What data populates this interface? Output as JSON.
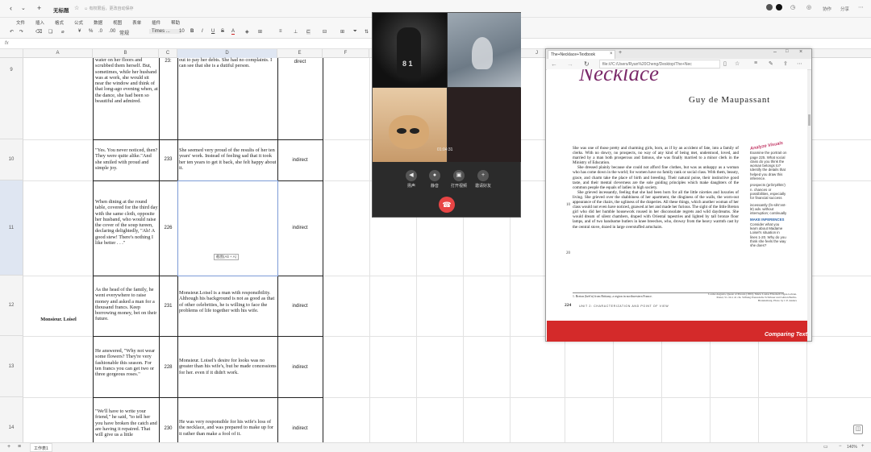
{
  "titlebar": {
    "doc_title": "无标题",
    "sync_text": "☺ 有权限后，更改自动保存",
    "collab_label": "协作",
    "share_label": "分享"
  },
  "menu": [
    "文件",
    "插入",
    "格式",
    "公式",
    "数据",
    "视图",
    "表单",
    "插件",
    "帮助"
  ],
  "toolbar": {
    "normal": "常规",
    "font": "Times ...",
    "font_size": "10",
    "percent": "%",
    "currency": "¥"
  },
  "formula_bar": {
    "cell_label": "fx"
  },
  "columns": [
    "A",
    "B",
    "C",
    "D",
    "E",
    "F",
    "G",
    "H",
    "I",
    "J"
  ],
  "rows": [
    {
      "num": "9",
      "quote": "water on her floors and scrubbed them herself. But, sometimes, while her husband was at work, she would sit near the window and think of that long-ago evening when, at the dance, she had been so beautiful and admired.",
      "page": "23:",
      "analysis": "out to pay her debts. She had no complaints. I can see that she is a dutiful person.",
      "type": "direct"
    },
    {
      "num": "10",
      "quote": "\"Yes. You never noticed, then? They were quite alike.\"And she smiled with proud and simple joy.",
      "page": "233",
      "analysis": "She seemed very proud of the results of her ten years' work. Instead of feeling sad that it took her ten years to get it back, she felt happy about it.",
      "type": "indirect"
    },
    {
      "num": "11",
      "quote": "When dining at the round table, covered for the third day with the same cloth, opposite her husband, who would raise the cover of the soup tureen, declaring delightedly, \"Ah! A good stew! There's nothing I like better . . .\"",
      "page": "226",
      "analysis": "",
      "type": "indirect"
    },
    {
      "num": "12",
      "quote": "As the head of the family, he went everywhere to raise money and asked a man for a thousand francs. Keep borrowing money, bet on their future.",
      "page": "231",
      "analysis": "Monsieur.Loisel is a man with responsibility. Although his background is not as good as that of other celebrities, he is willing to face the problems of life together with his wife.",
      "type": "indirect"
    },
    {
      "num": "13",
      "quote": "He answered, \"Why not wear some flowers? They're very fashionable this season. For ten francs you can get two or three gorgeous roses.\"",
      "page": "228",
      "analysis": "Monsieur. Loisel's desire for looks was no greater than his wife's, but he made concessions for her. even if it didn't work.",
      "type": "indirect"
    },
    {
      "num": "14",
      "quote": "\"We'll have to write your friend,\" he said, \"to tell her you have broken the catch and are having it repaired. That will give us a little",
      "page": "230",
      "analysis": "He was very responsible for his wife's loss of the necklace, and was prepared to make up for it rather than make a fool of it.",
      "type": "indirect"
    }
  ],
  "character_label": "Monsieur. Loisel",
  "paste_hint": "截图(Alt + A)",
  "statusbar": {
    "sheet_tab": "工作表1",
    "zoom": "140%"
  },
  "video_call": {
    "timer": "01:04:31",
    "buttons": [
      "扬声",
      "静音",
      "打开视频",
      "邀请好友"
    ],
    "numbers": "8 1"
  },
  "browser": {
    "tab_title": "The+Necklace+Textbook",
    "url": "file:///C:/Users/Ryan%20Cheng/Desktop/The+Nec",
    "title_script": "Necklace",
    "author": "Guy de Maupassant",
    "paragraph1": "She was one of those pretty and charming girls, born, as if by an accident of fate, into a family of clerks. With no dowry, no prospects, no way of any kind of being met, understood, loved, and married by a man both prosperous and famous, she was finally married to a minor clerk in the Ministry of Education.",
    "paragraph2": "She dressed plainly because she could not afford fine clothes, but was as unhappy as a woman who has come down in the world; for women have no family rank or social class. With them, beauty, grace, and charm take the place of birth and breeding. Their natural poise, their instinctive good taste, and their mental cleverness are the sole guiding principles which make daughters of the common people the equals of ladies in high society.",
    "paragraph3": "She grieved incessantly, feeling that she had been born for all the little niceties and luxuries of living. She grieved over the shabbiness of her apartment, the dinginess of the walls, the worn-out appearance of the chairs, the ugliness of the draperies. All these things, which another woman of her class would not even have noticed, gnawed at her and made her furious. The sight of the little Breton girl who did her humble housework roused in her disconsolate regrets and wild daydreams. She would dream of silent chambers, draped with Oriental tapestries and lighted by tall bronze floor lamps, and of two handsome butlers in knee breeches, who, drowsy from the heavy warmth cast by the central stove, dozed in large overstuffed armchairs.",
    "line_num_10": "10",
    "line_num_20": "20",
    "side_heading": "Analyze Visuals",
    "side_text": "Examine the portrait on page 225. What social class do you think the woman belongs to? Identify the details that helped you draw this inference.",
    "vocab1": "prospects (prŏs'pĕkts') n. chances or possibilities, especially for financial success",
    "vocab2": "incessantly (ĭn-sĕs'ənt-lē) adv. without interruption; continually",
    "make_inferences": "MAKE INFERENCES",
    "inference_text": "Consider what you learn about Madame Loisel's situation in lines 1-20. Why do you think she feels the way she does?",
    "footnote": "1. Breton (brĕt'n) from Brittany, a region in northwestern France.",
    "credit": "Louise Augusta, Queen of Prussia (1801), Marie Louise Elisabeth Vigée-Lebrun. Pastel, 51 cm x 41 cm. Stiftung Preussische Schlösser und Gärten Berlin-Brandenburg. Photo by J. P. Anders",
    "page_number": "224",
    "unit_line": "UNIT 2: CHARACTERIZATION AND POINT OF VIEW",
    "footer_banner": "Comparing Text"
  },
  "colors": {
    "accent": "#d42a2a",
    "call_red": "#e84545",
    "purple": "#7b2a6a"
  }
}
